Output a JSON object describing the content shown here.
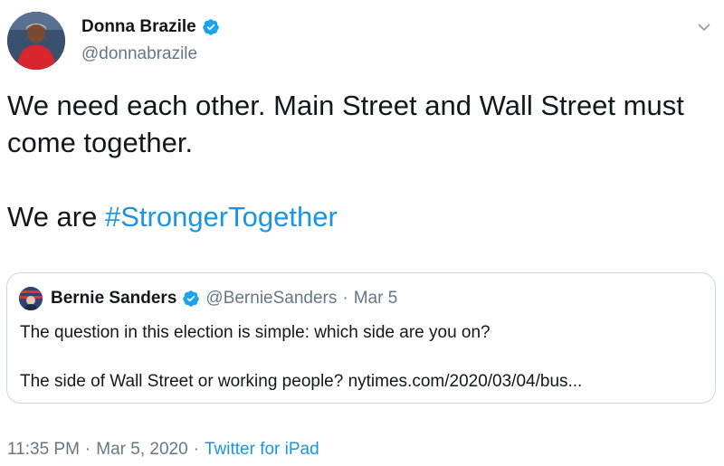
{
  "author": {
    "name": "Donna Brazile",
    "handle": "@donnabrazile"
  },
  "tweet": {
    "line1": "We need each other. Main Street and Wall Street must",
    "line2": "come together.",
    "line3_prefix": "We are ",
    "hashtag": "#StrongerTogether"
  },
  "quoted": {
    "name": "Bernie Sanders",
    "handle": "@BernieSanders",
    "separator": "·",
    "date": "Mar 5",
    "line1": "The question in this election is simple: which side are you on?",
    "line2": "The side of Wall Street or working people? nytimes.com/2020/03/04/bus..."
  },
  "meta": {
    "time": "11:35 PM",
    "dot1": "·",
    "date": "Mar 5, 2020",
    "dot2": "·",
    "source": "Twitter for iPad"
  },
  "colors": {
    "link": "#1b95e0",
    "secondary_text": "#657786",
    "border": "#ccd6dd",
    "verified": "#1da1f2"
  },
  "icons": {
    "verified": "verified-badge-icon",
    "menu": "chevron-down-icon"
  }
}
